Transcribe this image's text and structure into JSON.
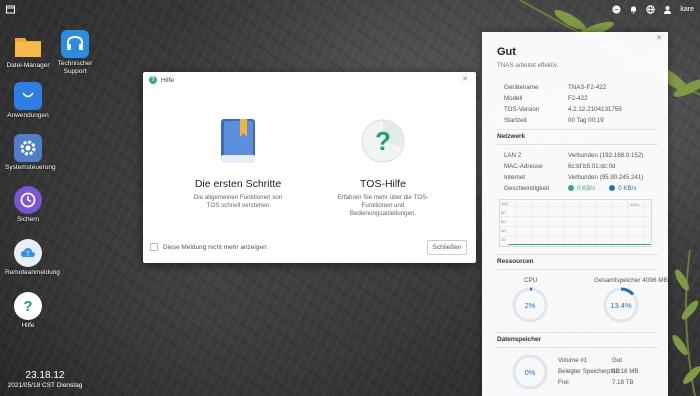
{
  "desktop": {
    "items": [
      {
        "label": "Datei-Manager",
        "icon": "folder-icon"
      },
      {
        "label": "Technischer Support",
        "icon": "headset-icon"
      },
      {
        "label": "Anwendungen",
        "icon": "shopping-bag-icon"
      },
      {
        "label": "Systemsteuerung",
        "icon": "gear-icon"
      },
      {
        "label": "Sichern",
        "icon": "backup-clock-icon"
      },
      {
        "label": "Remoteanmeldung",
        "icon": "remote-login-icon"
      },
      {
        "label": "Hilfe",
        "icon": "help-icon"
      }
    ],
    "clock": {
      "time": "23.18.12",
      "date": "2021/05/18 CST Dienstag"
    }
  },
  "topbar": {
    "user": "kare"
  },
  "dialog": {
    "title": "Hilfe",
    "cards": [
      {
        "title": "Die ersten Schritte",
        "desc_line1": "Die allgemeinen Funktionen von",
        "desc_line2": "TOS schnell verstehen",
        "icon": "book-icon"
      },
      {
        "title": "TOS-Hilfe",
        "desc_line1": "Erfahren Sie mehr über die TOS-",
        "desc_line2": "Funktionen und",
        "desc_line3": "Bedienungsanleitungen.",
        "icon": "help-circle-icon"
      }
    ],
    "checkbox_label": "Diese Meldung nicht mehr anzeigen",
    "close_label": "Schließen"
  },
  "panel": {
    "status": "Gut",
    "status_sub": "TNAS arbeitet effektiv.",
    "device": [
      {
        "k": "Gerätename",
        "v": "TNAS-F2-422"
      },
      {
        "k": "Modell",
        "v": "F2-422"
      },
      {
        "k": "TOS-Version",
        "v": "4.2.12-2104131759"
      },
      {
        "k": "Startzeit",
        "v": "00 Tag 00:19"
      }
    ],
    "network_title": "Netzwerk",
    "network": [
      {
        "k": "LAN 2",
        "v": "Verbunden (192.168.0.152)"
      },
      {
        "k": "MAC-Adresse",
        "v": "6c:bf:b5:01:dc:0d"
      },
      {
        "k": "Internet",
        "v": "Verbunden (95.90.245.241)"
      }
    ],
    "speed_label": "Geschwindigkeit",
    "speed_up": "0 KB/s",
    "speed_down": "0 KB/s",
    "graph_labels": {
      "right": "KB/s",
      "y1": "100",
      "y2": "80",
      "y3": "60",
      "y4": "40",
      "y5": "20"
    },
    "resources_title": "Ressourcen",
    "cpu_label": "CPU",
    "cpu_value": "2%",
    "cpu_fraction": 0.02,
    "mem_label": "Gesamtspeicher 4096 MB",
    "mem_value": "13.4%",
    "mem_fraction": 0.134,
    "storage_title": "Datenspeicher",
    "storage_value": "0%",
    "storage_fraction": 0.0,
    "volume": [
      {
        "k": "Volume #1",
        "v": "Gut"
      },
      {
        "k": "Belegter Speicherplatz",
        "v": "92.18 MB"
      },
      {
        "k": "Frei",
        "v": "7.18 TB"
      }
    ],
    "colors": {
      "accent": "#1a73c9",
      "ok": "#2fb36b",
      "download": "#1a73c9"
    }
  }
}
